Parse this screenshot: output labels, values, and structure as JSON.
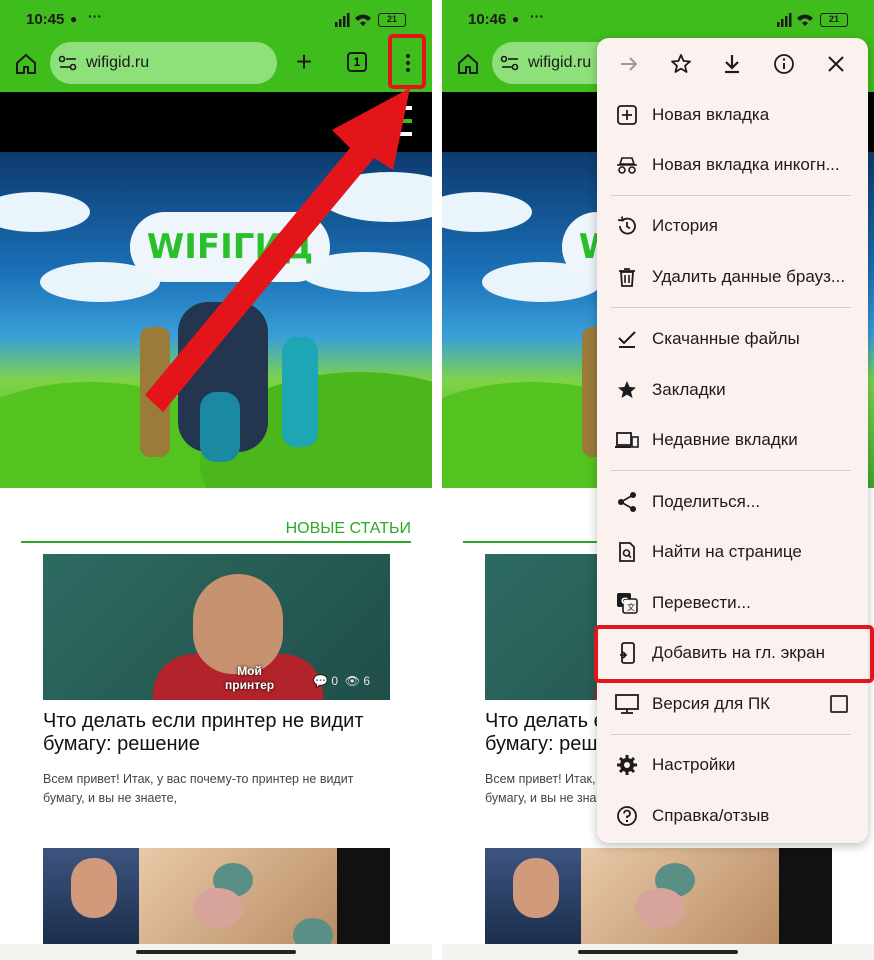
{
  "left": {
    "status": {
      "time": "10:45",
      "battery": "21"
    },
    "url": "wifigid.ru",
    "tab_count": "1",
    "logo_text": "WIFIГИД",
    "section_title": "НОВЫЕ СТАТЬИ",
    "article": {
      "title": "Что делать если принтер не видит бумагу: решение",
      "excerpt": "Всем привет! Итак, у вас почему-то принтер не видит бумагу, и вы не знаете,",
      "caption_line1": "Мой",
      "caption_line2": "принтер",
      "comments": "0",
      "views": "6"
    }
  },
  "right": {
    "status": {
      "time": "10:46",
      "battery": "21"
    },
    "url": "wifigid.ru",
    "article_title": "Что делать если принтер не видит бумагу: реше",
    "article_excerpt": "Всем привет! Итак, у вас почему-то принтер не видит бумагу, и вы не знаете,"
  },
  "menu": {
    "items": [
      {
        "label": "Новая вкладка",
        "icon": "new-tab-icon"
      },
      {
        "label": "Новая вкладка инкогн...",
        "icon": "incognito-icon"
      },
      {
        "label": "История",
        "icon": "history-icon"
      },
      {
        "label": "Удалить данные брауз...",
        "icon": "trash-icon"
      },
      {
        "label": "Скачанные файлы",
        "icon": "downloads-icon"
      },
      {
        "label": "Закладки",
        "icon": "star-icon"
      },
      {
        "label": "Недавние вкладки",
        "icon": "devices-icon"
      },
      {
        "label": "Поделиться...",
        "icon": "share-icon"
      },
      {
        "label": "Найти на странице",
        "icon": "find-in-page-icon"
      },
      {
        "label": "Перевести...",
        "icon": "translate-icon"
      },
      {
        "label": "Добавить на гл. экран",
        "icon": "add-to-home-icon"
      },
      {
        "label": "Версия для ПК",
        "icon": "desktop-icon"
      },
      {
        "label": "Настройки",
        "icon": "settings-icon"
      },
      {
        "label": "Справка/отзыв",
        "icon": "help-icon"
      }
    ]
  },
  "colors": {
    "accent": "#3fbd1c",
    "highlight": "#e3151b",
    "menu_bg": "#fbf1ef"
  }
}
